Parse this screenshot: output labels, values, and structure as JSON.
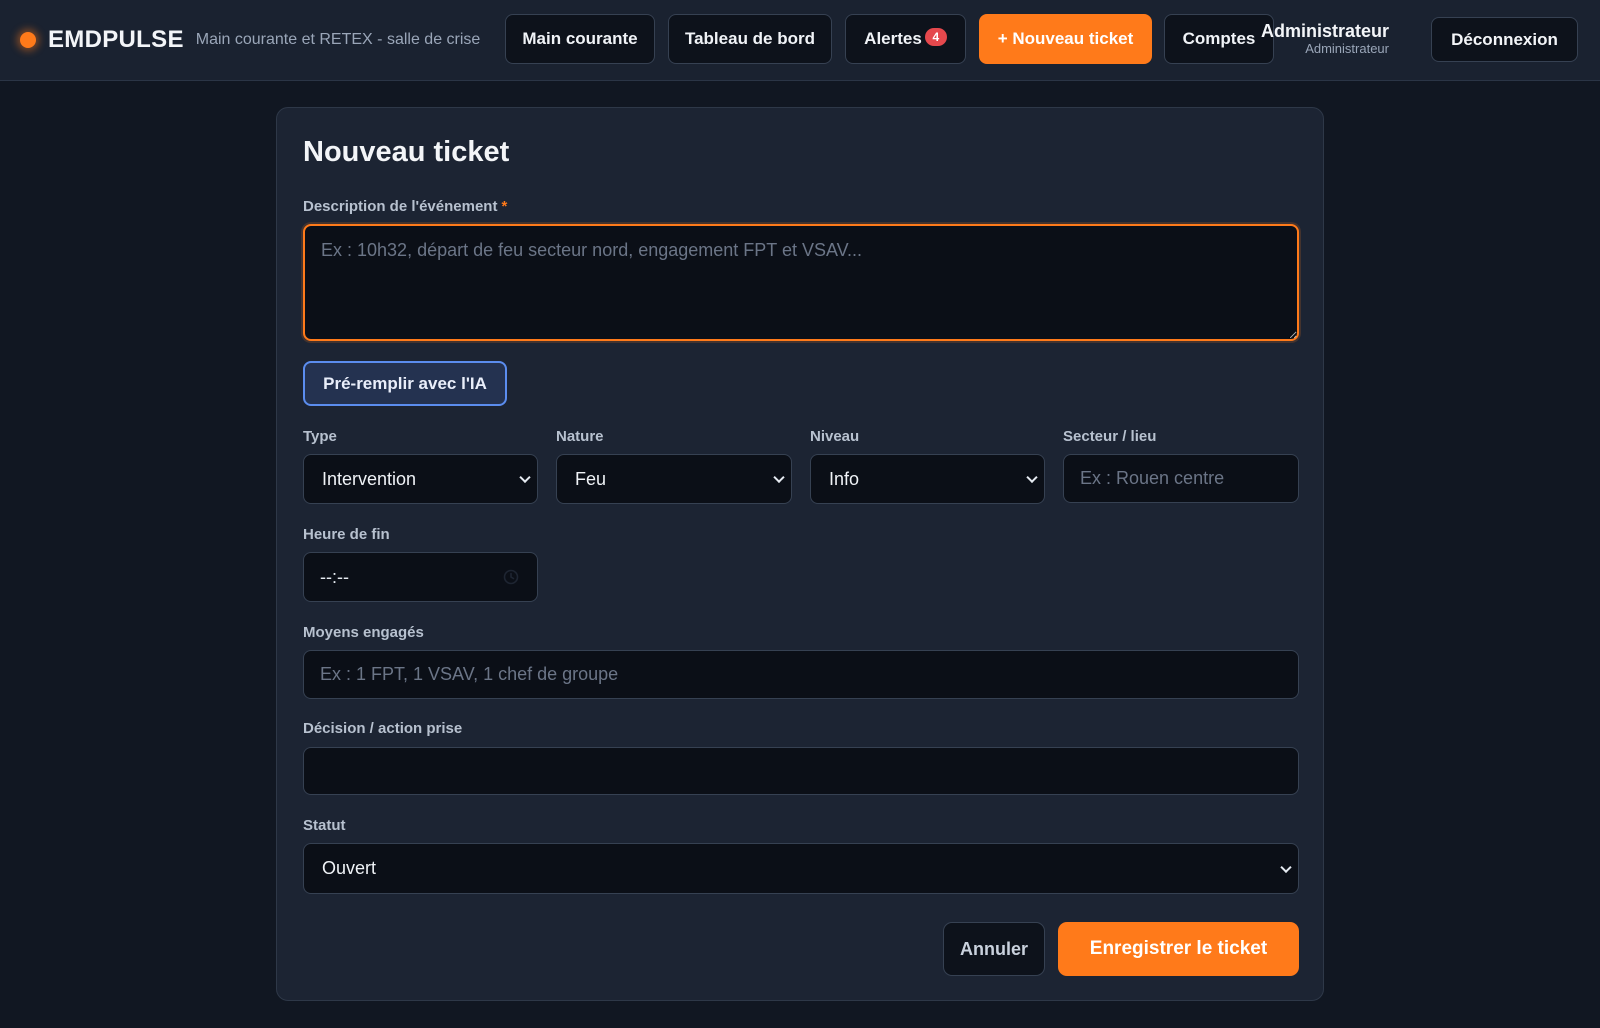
{
  "brand": {
    "name": "EMDPULSE",
    "subtitle": "Main courante et RETEX - salle de crise",
    "accent_color": "#ff7a1a"
  },
  "nav": {
    "main_courante": "Main courante",
    "tableau_de_bord": "Tableau de bord",
    "alertes": "Alertes",
    "alertes_count": "4",
    "nouveau_ticket": "+ Nouveau ticket",
    "comptes": "Comptes"
  },
  "user": {
    "name": "Administrateur",
    "role": "Administrateur",
    "logout_label": "Déconnexion"
  },
  "form": {
    "title": "Nouveau ticket",
    "description": {
      "label": "Description de l'événement",
      "required_mark": "*",
      "placeholder": "Ex : 10h32, départ de feu secteur nord, engagement FPT et VSAV...",
      "value": ""
    },
    "ai_button_label": "Pré-remplir avec l'IA",
    "type": {
      "label": "Type",
      "value": "Intervention"
    },
    "nature": {
      "label": "Nature",
      "value": "Feu"
    },
    "niveau": {
      "label": "Niveau",
      "value": "Info"
    },
    "secteur": {
      "label": "Secteur / lieu",
      "placeholder": "Ex : Rouen centre",
      "value": ""
    },
    "heure_fin": {
      "label": "Heure de fin",
      "value": "--:--"
    },
    "moyens": {
      "label": "Moyens engagés",
      "placeholder": "Ex : 1 FPT, 1 VSAV, 1 chef de groupe",
      "value": ""
    },
    "decision": {
      "label": "Décision / action prise",
      "placeholder": "",
      "value": ""
    },
    "statut": {
      "label": "Statut",
      "value": "Ouvert"
    },
    "cancel_label": "Annuler",
    "save_label": "Enregistrer le ticket"
  },
  "icons": {
    "brand": "status-dot-icon",
    "time": "clock-icon",
    "select": "chevron-down-icon"
  }
}
